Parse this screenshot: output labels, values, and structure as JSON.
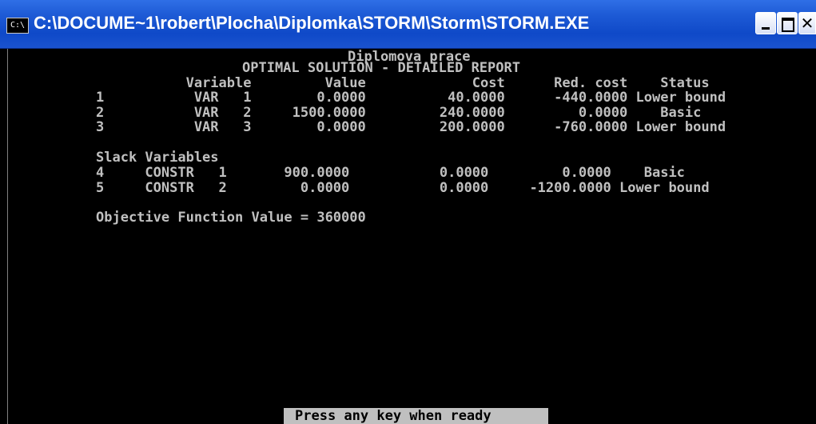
{
  "window": {
    "title": "C:\\DOCUME~1\\robert\\Plocha\\Diplomka\\STORM\\Storm\\STORM.EXE",
    "icon": "C:\\",
    "close_glyph": "✕"
  },
  "console": {
    "report_title": "Diplomova prace",
    "report_subtitle": "OPTIMAL SOLUTION - DETAILED REPORT",
    "header_row": "           Variable         Value             Cost      Red. cost    Status",
    "rows": [
      "1           VAR   1        0.0000          40.0000      -440.0000 Lower bound",
      "2           VAR   2     1500.0000         240.0000         0.0000    Basic",
      "3           VAR   3        0.0000         200.0000      -760.0000 Lower bound"
    ],
    "slack_header": "Slack Variables",
    "slack_rows": [
      "4     CONSTR   1       900.0000           0.0000         0.0000    Basic",
      "5     CONSTR   2         0.0000           0.0000     -1200.0000 Lower bound"
    ],
    "objective": "Objective Function Value = 360000"
  },
  "status": {
    "prompt": "Press any key when ready"
  }
}
